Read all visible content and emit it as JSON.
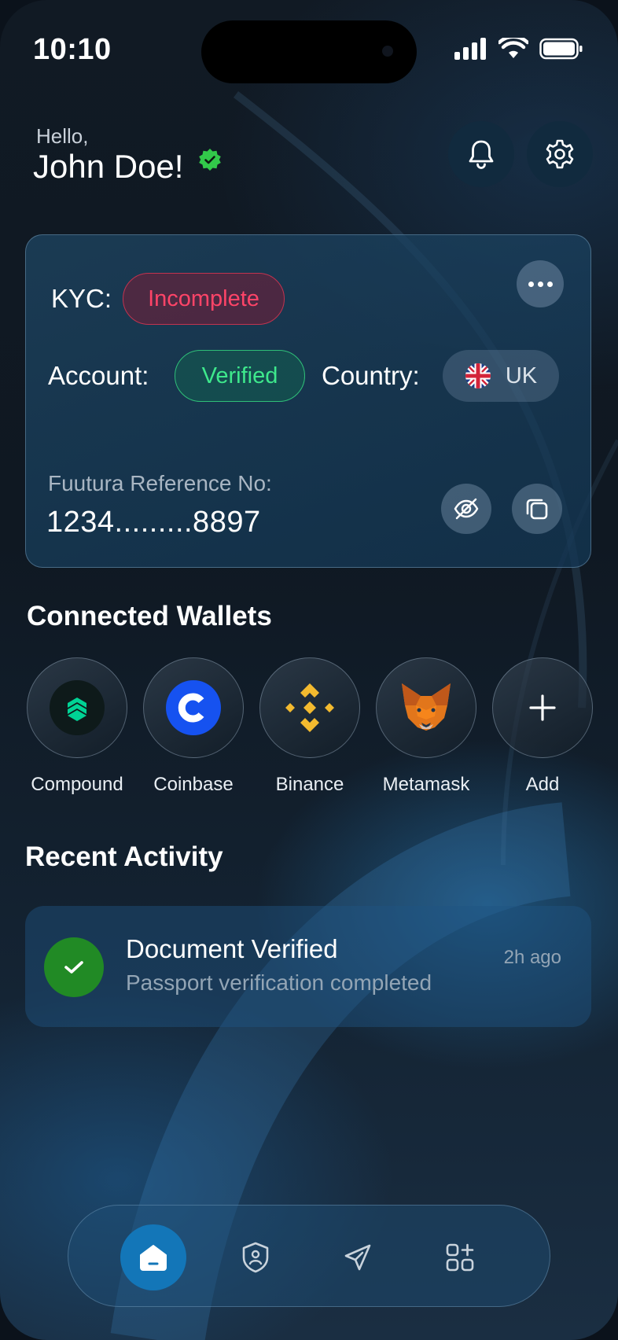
{
  "status_bar": {
    "time": "10:10"
  },
  "header": {
    "greeting": "Hello,",
    "user_name": "John Doe!"
  },
  "kyc_card": {
    "kyc_label": "KYC:",
    "kyc_status": "Incomplete",
    "account_label": "Account:",
    "account_status": "Verified",
    "country_label": "Country:",
    "country_value": "UK",
    "reference_label": "Fuutura Reference No:",
    "reference_value": "1234.........8897"
  },
  "wallets": {
    "title": "Connected Wallets",
    "items": [
      {
        "label": "Compound",
        "icon": "compound-logo-icon"
      },
      {
        "label": "Coinbase",
        "icon": "coinbase-logo-icon"
      },
      {
        "label": "Binance",
        "icon": "binance-logo-icon"
      },
      {
        "label": "Metamask",
        "icon": "metamask-logo-icon"
      },
      {
        "label": "Add",
        "icon": "plus-icon"
      }
    ]
  },
  "activity": {
    "title": "Recent Activity",
    "items": [
      {
        "title": "Document Verified",
        "subtitle": "Passport verification completed",
        "time": "2h ago"
      }
    ]
  },
  "nav": {
    "items": [
      "home-icon",
      "shield-user-icon",
      "send-icon",
      "apps-add-icon"
    ],
    "active": "home-icon"
  },
  "colors": {
    "accent": "#1376b8",
    "status_incomplete": "#ff4468",
    "status_verified": "#3ee88c",
    "activity_success": "#218a25"
  }
}
